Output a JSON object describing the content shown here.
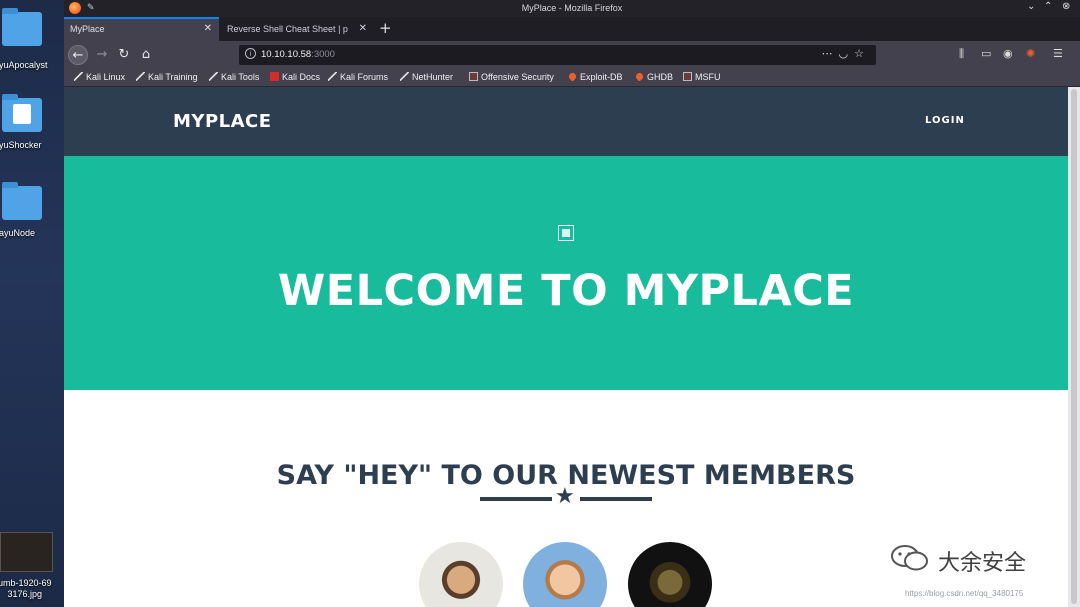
{
  "desktop": {
    "icons": [
      {
        "label": "ayuApocalyst"
      },
      {
        "label": "ayuShocker"
      },
      {
        "label": "dayuNode"
      },
      {
        "label": "umb-1920-69\n3176.jpg"
      }
    ]
  },
  "window": {
    "title": "MyPlace - Mozilla Firefox"
  },
  "tabs": [
    {
      "label": "MyPlace",
      "active": true
    },
    {
      "label": "Reverse Shell Cheat Sheet | p",
      "active": false
    }
  ],
  "urlbar": {
    "host": "10.10.10.58",
    "port": ":3000"
  },
  "bookmarks": [
    {
      "label": "Kali Linux",
      "icon": "kali-dragon-icon"
    },
    {
      "label": "Kali Training",
      "icon": "kali-dragon-icon"
    },
    {
      "label": "Kali Tools",
      "icon": "kali-dragon-icon"
    },
    {
      "label": "Kali Docs",
      "icon": "kali-docs-icon"
    },
    {
      "label": "Kali Forums",
      "icon": "kali-dragon-icon"
    },
    {
      "label": "NetHunter",
      "icon": "nethunter-icon"
    },
    {
      "label": "Offensive Security",
      "icon": "offsec-icon"
    },
    {
      "label": "Exploit-DB",
      "icon": "exploitdb-icon"
    },
    {
      "label": "GHDB",
      "icon": "ghdb-icon"
    },
    {
      "label": "MSFU",
      "icon": "msfu-icon"
    }
  ],
  "site": {
    "brand": "MYPLACE",
    "login": "LOGIN",
    "hero_title": "WELCOME TO MYPLACE",
    "members_title": "SAY \"HEY\" TO OUR NEWEST MEMBERS",
    "colors": {
      "nav": "#2c3e50",
      "hero": "#18bc9c",
      "heading": "#2c3e50"
    }
  },
  "watermark": {
    "text": "大余安全",
    "url": "https://blog.csdn.net/qq_3480175"
  }
}
